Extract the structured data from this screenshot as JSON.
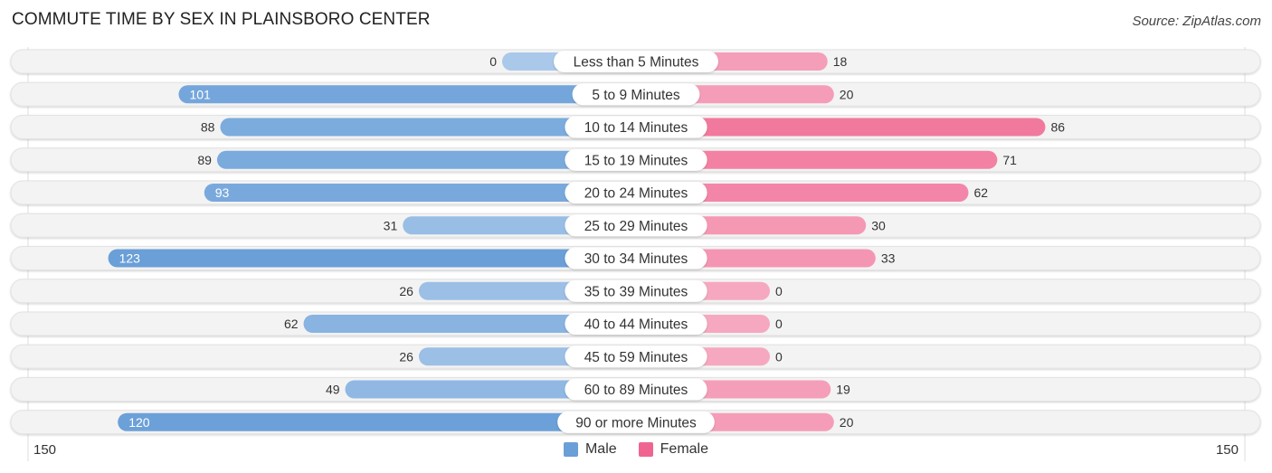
{
  "header": {
    "title": "COMMUTE TIME BY SEX IN PLAINSBORO CENTER",
    "source": "Source: ZipAtlas.com"
  },
  "colors": {
    "male": "#6a9fd8",
    "male_light": "#a9c8ea",
    "female": "#f06590",
    "female_light": "#f6a8c0",
    "row_bg": "#f3f3f3",
    "label_pill": "#ffffff"
  },
  "chart_data": {
    "type": "bar",
    "orientation": "horizontal-diverging",
    "title": "COMMUTE TIME BY SEX IN PLAINSBORO CENTER",
    "categories": [
      "Less than 5 Minutes",
      "5 to 9 Minutes",
      "10 to 14 Minutes",
      "15 to 19 Minutes",
      "20 to 24 Minutes",
      "25 to 29 Minutes",
      "30 to 34 Minutes",
      "35 to 39 Minutes",
      "40 to 44 Minutes",
      "45 to 59 Minutes",
      "60 to 89 Minutes",
      "90 or more Minutes"
    ],
    "series": [
      {
        "name": "Male",
        "values": [
          0,
          101,
          88,
          89,
          93,
          31,
          123,
          26,
          62,
          26,
          49,
          120
        ]
      },
      {
        "name": "Female",
        "values": [
          18,
          20,
          86,
          71,
          62,
          30,
          33,
          0,
          0,
          0,
          19,
          20
        ]
      }
    ],
    "axis": {
      "left_label": "150",
      "right_label": "150",
      "range": [
        0,
        150
      ]
    },
    "legend": {
      "position": "bottom-center",
      "entries": [
        "Male",
        "Female"
      ]
    },
    "xlabel": "",
    "ylabel": ""
  }
}
